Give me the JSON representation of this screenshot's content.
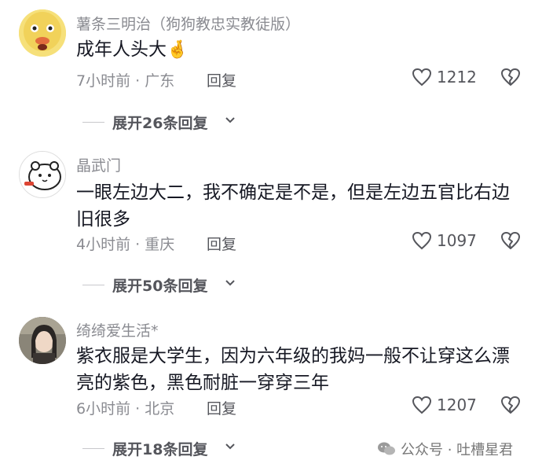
{
  "comments": [
    {
      "username": "薯条三明治（狗狗教忠实教徒版）",
      "text": "成年人头大",
      "emoji": "🤞",
      "meta": "7小时前 · 广东",
      "reply_label": "回复",
      "likes": "1212",
      "expand_label": "展开26条回复"
    },
    {
      "username": "晶武门",
      "text": "一眼左边大二，我不确定是不是，但是左边五官比右边旧很多",
      "meta": "4小时前 · 重庆",
      "reply_label": "回复",
      "likes": "1097",
      "expand_label": "展开50条回复"
    },
    {
      "username": "绮绮爱生活*",
      "text": "紫衣服是大学生，因为六年级的我妈一般不让穿这么漂亮的紫色，黑色耐脏一穿穿三年",
      "meta": "6小时前 · 北京",
      "reply_label": "回复",
      "likes": "1207",
      "expand_label": "展开18条回复"
    }
  ],
  "watermark": "公众号 · 吐槽星君",
  "colors": {
    "text": "#161823",
    "meta": "#8a8b91",
    "icon": "#55565c"
  }
}
